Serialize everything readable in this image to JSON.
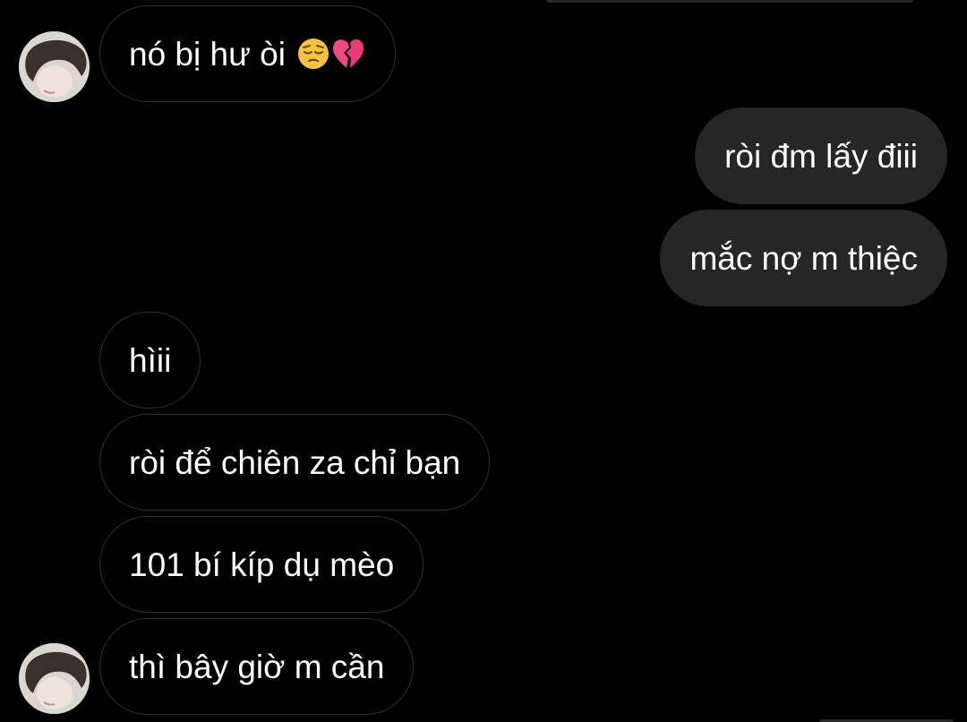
{
  "conversation": {
    "messages": [
      {
        "sender": "other",
        "text": "nó bị hư òi",
        "emojis": [
          "pensive-face",
          "broken-heart"
        ]
      },
      {
        "sender": "me",
        "text": "ròi đm lấy điii"
      },
      {
        "sender": "me",
        "text": "mắc nợ m thiệc"
      },
      {
        "sender": "other",
        "text": "hìii"
      },
      {
        "sender": "other",
        "text": "ròi để chiên za chỉ bạn"
      },
      {
        "sender": "other",
        "text": "101 bí kíp dụ mèo"
      },
      {
        "sender": "other",
        "text": "thì bây giờ m cần"
      }
    ]
  },
  "colors": {
    "background": "#000000",
    "outgoing_bubble": "#262626",
    "incoming_border": "#2f2f2f",
    "text": "#ffffff"
  }
}
